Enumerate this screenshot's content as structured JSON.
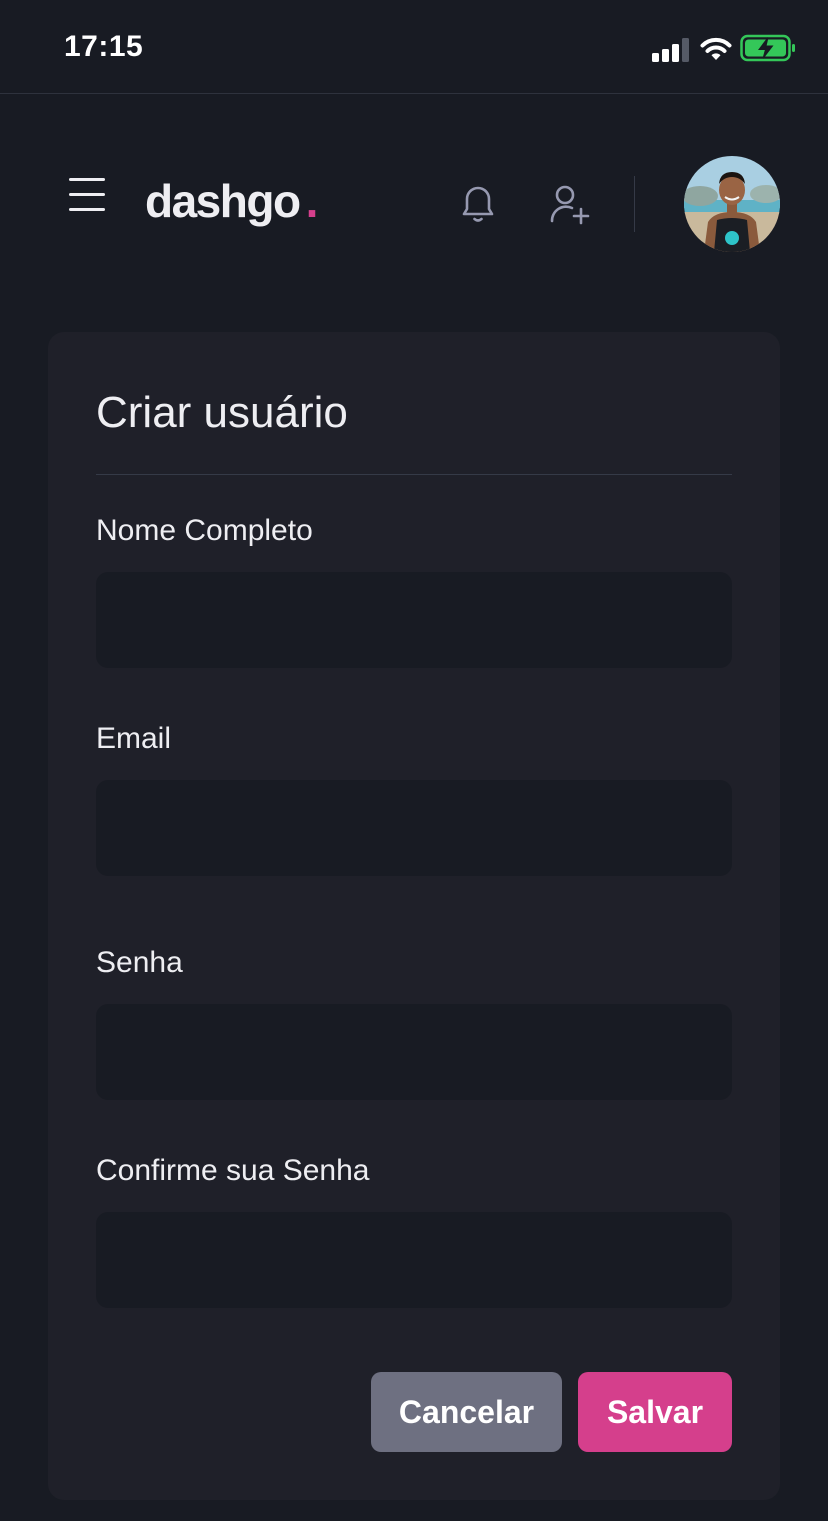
{
  "status_bar": {
    "time": "17:15"
  },
  "header": {
    "logo_text": "dashgo",
    "logo_dot": ".",
    "menu_icon": "hamburger-menu-icon",
    "notification_icon": "bell-icon",
    "add_user_icon": "user-plus-icon"
  },
  "form": {
    "title": "Criar usuário",
    "fields": [
      {
        "label": "Nome Completo",
        "value": "",
        "placeholder": ""
      },
      {
        "label": "Email",
        "value": "",
        "placeholder": ""
      },
      {
        "label": "Senha",
        "value": "",
        "placeholder": ""
      },
      {
        "label": "Confirme sua Senha",
        "value": "",
        "placeholder": ""
      }
    ],
    "cancel_label": "Cancelar",
    "save_label": "Salvar"
  },
  "colors": {
    "background": "#181b23",
    "card": "#1f2029",
    "input": "#181b23",
    "accent": "#d53f8c",
    "cancel_button": "#6e7081",
    "battery_green": "#34c759"
  }
}
